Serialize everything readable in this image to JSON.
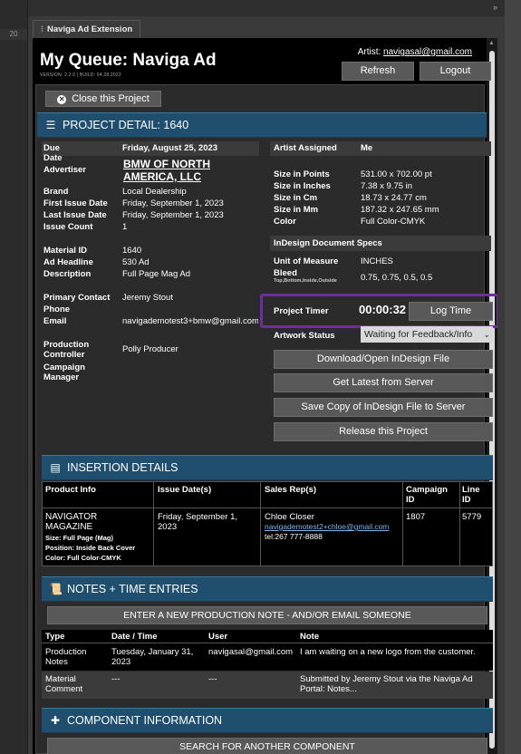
{
  "host": {
    "ruler_label": "20"
  },
  "panel_tab": {
    "label": "Naviga Ad Extension"
  },
  "header": {
    "title": "My Queue: Naviga Ad",
    "version": "VERSION: 2.2.0 | BUILD: 04.28.2022",
    "artist_prefix": "Artist:",
    "artist_email": "navigasal@gmail.com",
    "refresh_label": "Refresh",
    "logout_label": "Logout"
  },
  "close_project_label": "Close this Project",
  "project_detail": {
    "section_title": "PROJECT DETAIL: 1640",
    "due_date_label": "Due Date",
    "due_date": "Friday, August 25, 2023",
    "advertiser_label": "Advertiser",
    "advertiser_line1": "BMW OF NORTH",
    "advertiser_line2": "AMERICA, LLC",
    "brand_label": "Brand",
    "brand": "Local Dealership",
    "first_issue_label": "First Issue Date",
    "first_issue": "Friday, September 1, 2023",
    "last_issue_label": "Last Issue Date",
    "last_issue": "Friday, September 1, 2023",
    "issue_count_label": "Issue Count",
    "issue_count": "1",
    "material_id_label": "Material ID",
    "material_id": "1640",
    "headline_label": "Ad Headline",
    "headline": "530 Ad",
    "description_label": "Description",
    "description": "Full Page Mag Ad",
    "primary_contact_label": "Primary Contact",
    "primary_contact": "Jeremy Stout",
    "phone_label": "Phone",
    "phone": "",
    "email_label": "Email",
    "email": "navigademotest3+bmw@gmail.com",
    "production_controller_label_1": "Production",
    "production_controller_label_2": "Controller",
    "production_controller": "Polly Producer",
    "campaign_manager_label_1": "Campaign",
    "campaign_manager_label_2": "Manager",
    "campaign_manager": "",
    "artist_assigned_label": "Artist Assigned",
    "artist_assigned": "Me",
    "size_points_label": "Size in Points",
    "size_points": "531.00 x 702.00 pt",
    "size_inches_label": "Size in Inches",
    "size_inches": "7.38 x 9.75 in",
    "size_cm_label": "Size in Cm",
    "size_cm": "18.73 x 24.77 cm",
    "size_mm_label": "Size in Mm",
    "size_mm": "187.32 x 247.65 mm",
    "color_label": "Color",
    "color": "Full Color-CMYK",
    "indesign_specs_label": "InDesign Document Specs",
    "unit_label": "Unit of Measure",
    "unit": "INCHES",
    "bleed_label": "Bleed",
    "bleed_sub": "Top,Bottom,Inside,Outside",
    "bleed": "0.75, 0.75, 0.5, 0.5",
    "timer_label": "Project Timer",
    "timer_value": "00:00:32",
    "log_time_label": "Log Time",
    "artwork_status_label": "Artwork Status",
    "artwork_status_value": "Waiting for Feedback/Info",
    "download_label": "Download/Open InDesign File",
    "get_latest_label": "Get Latest from Server",
    "save_copy_label": "Save Copy of InDesign File to Server",
    "release_label": "Release this Project"
  },
  "insertion": {
    "section_title": "INSERTION DETAILS",
    "headers": [
      "Product Info",
      "Issue Date(s)",
      "Sales Rep(s)",
      "Campaign",
      "ID",
      "Line",
      "ID"
    ],
    "product_name_1": "NAVIGATOR",
    "product_name_2": "MAGAZINE",
    "size": "Size: Full Page (Mag)",
    "position": "Position: Inside Back Cover",
    "color": "Color: Full Color-CMYK",
    "issue_date_1": "Friday, September 1,",
    "issue_date_2": "2023",
    "rep_name": "Chloe Closer",
    "rep_email": "navigademotest2+chloe@gmail.com",
    "rep_tel": "tel:267 777-8888",
    "campaign_id": "1807",
    "line_id": "5779"
  },
  "notes": {
    "section_title": "NOTES + TIME ENTRIES",
    "new_note_label": "ENTER A NEW PRODUCTION NOTE - AND/OR EMAIL SOMEONE",
    "headers": [
      "Type",
      "Date / Time",
      "User",
      "Note"
    ],
    "rows": [
      {
        "type_1": "Production",
        "type_2": "Notes",
        "date_1": "Tuesday, January 31,",
        "date_2": "2023",
        "user": "navigasal@gmail.com",
        "note_1": "I am waiting on a new logo from the customer.",
        "note_2": ""
      },
      {
        "type_1": "Material",
        "type_2": "Comment",
        "date_1": "---",
        "date_2": "",
        "user": "---",
        "note_1": "Submitted by Jeremy Stout via the Naviga Ad",
        "note_2": "Portal: Notes..."
      }
    ]
  },
  "component": {
    "section_title": "COMPONENT INFORMATION",
    "search_label": "SEARCH FOR ANOTHER COMPONENT"
  }
}
